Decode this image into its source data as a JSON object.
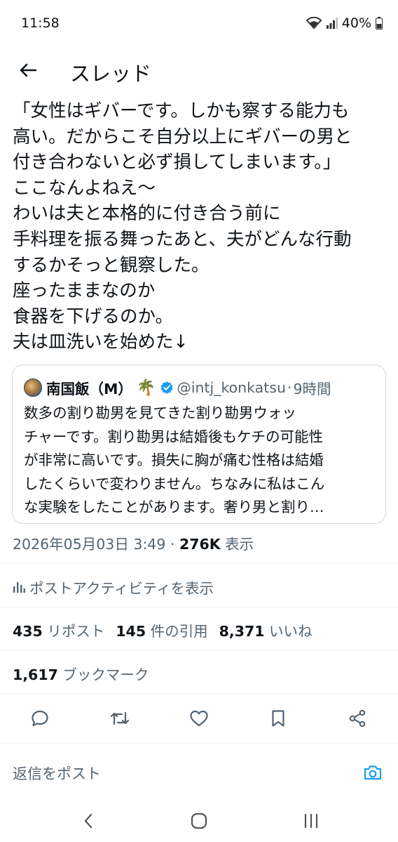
{
  "status_bar": {
    "time": "11:58",
    "battery": "40%"
  },
  "header": {
    "title": "スレッド"
  },
  "tweet": {
    "text": "「女性はギバーです。しかも察する能力も\n高い。だからこそ自分以上にギバーの男と\n付き合わないと必ず損してしまいます。」\nここなんよねえ〜\nわいは夫と本格的に付き合う前に\n手料理を振る舞ったあと、夫がどんな行動\nするかそっと観察した。\n座ったままなのか\n食器を下げるのか。\n夫は皿洗いを始めた↓"
  },
  "quote": {
    "name": "南国飯（M）",
    "emoji": "🌴",
    "handle": "@intj_konkatsu",
    "separator": "·",
    "time": "9時間",
    "text": "数多の割り勘男を見てきた割り勘男ウォッ\nチャーです。割り勘男は結婚後もケチの可能性\nが非常に高いです。損失に胸が痛む性格は結婚\nしたくらいで変わりません。ちなみに私はこん\nな実験をしたことがあります。奢り男と割り…"
  },
  "meta": {
    "timestamp": "2026年05月03日 3:49 · ",
    "views": "276K",
    "views_label": " 表示"
  },
  "activity_label": "ポストアクティビティを表示",
  "stats": {
    "reposts": "435",
    "reposts_label": " リポスト",
    "quotes": "145",
    "quotes_label": " 件の引用",
    "likes": "8,371",
    "likes_label": " いいね",
    "bookmarks": "1,617",
    "bookmarks_label": " ブックマーク"
  },
  "reply": {
    "placeholder": "返信をポスト"
  },
  "icons": {
    "back": "arrow-left-icon",
    "verified": "verified-badge-icon",
    "activity": "bar-chart-icon",
    "reply": "reply-icon",
    "retweet": "retweet-icon",
    "like": "heart-icon",
    "bookmark": "bookmark-icon",
    "share": "share-icon",
    "camera": "camera-icon"
  },
  "colors": {
    "accent": "#1d9bf0",
    "text": "#0f1419",
    "secondary": "#536471",
    "border": "#cfd9de"
  }
}
